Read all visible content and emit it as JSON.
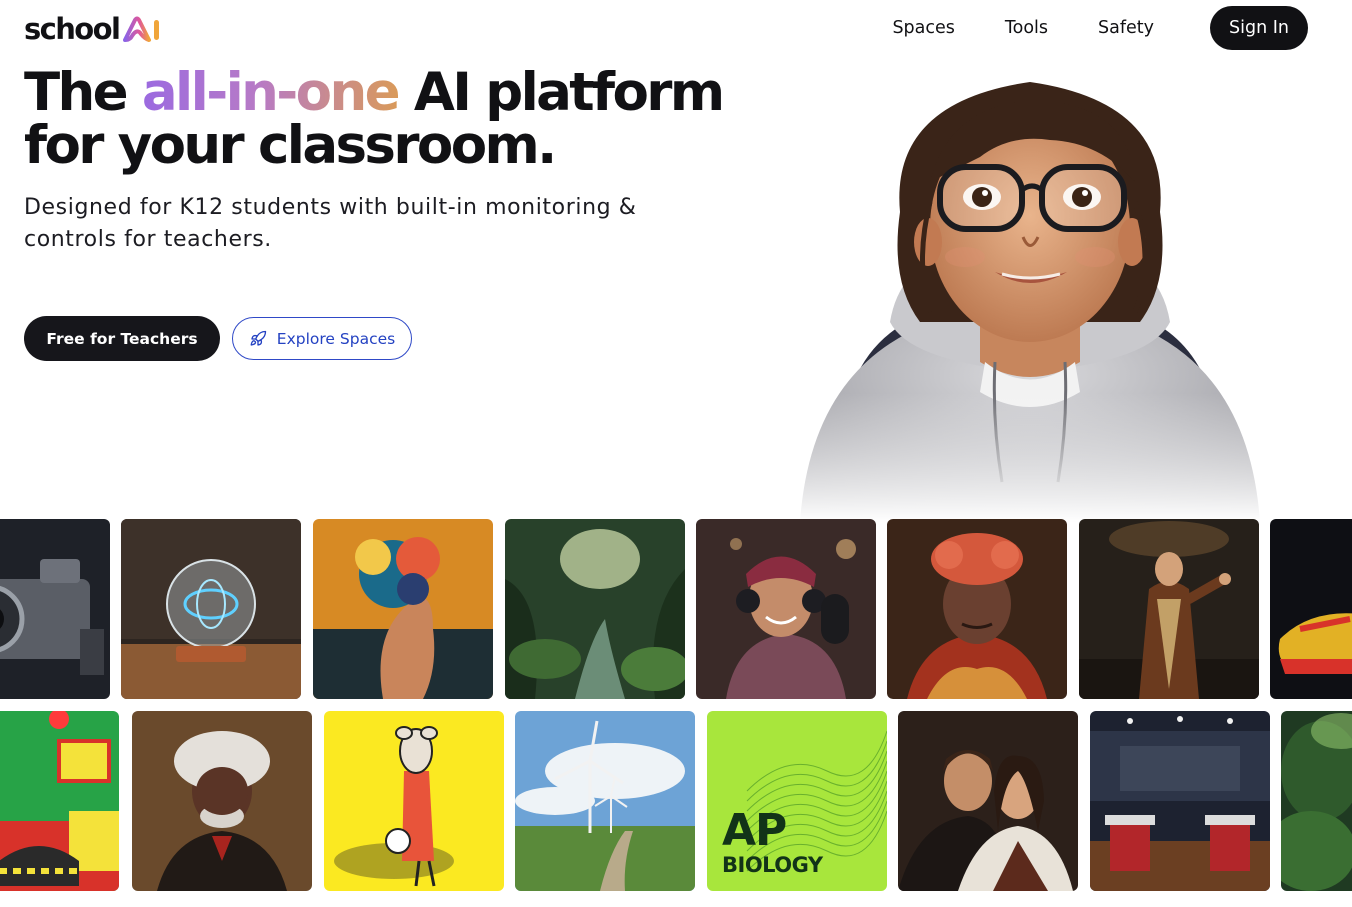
{
  "header": {
    "logo_text": "school",
    "nav": [
      "Spaces",
      "Tools",
      "Safety"
    ],
    "signin_label": "Sign In"
  },
  "hero": {
    "title_start": "The ",
    "title_highlight": "all-in-one",
    "title_end": " AI platform for your classroom.",
    "subtitle": "Designed for K12 students with built-in monitoring & controls for teachers.",
    "primary_cta": "Free for Teachers",
    "secondary_cta": "Explore Spaces"
  },
  "gallery": {
    "ap_tile": {
      "big": "AP",
      "small": "BIOLOGY"
    }
  },
  "colors": {
    "dark": "#111114",
    "accent_blue": "#2442c2",
    "gradient_start": "#9b6ae0",
    "gradient_end": "#d99a5a"
  }
}
